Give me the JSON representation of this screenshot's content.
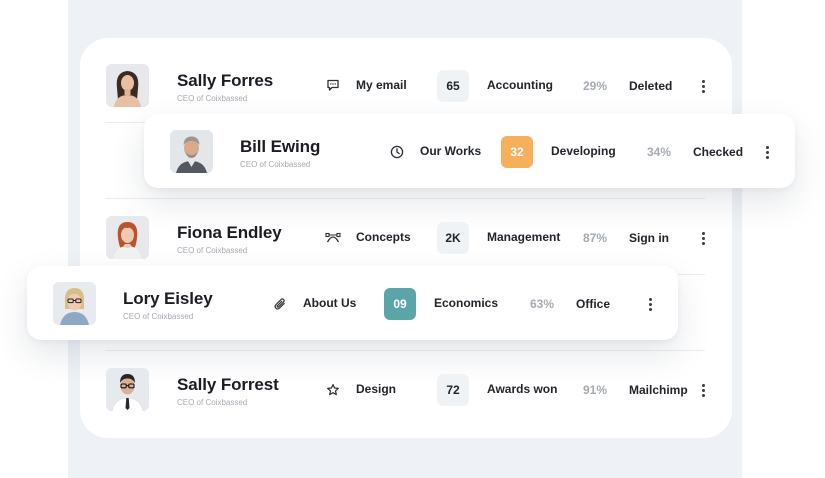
{
  "colors": {
    "background_panel": "#eef2f6",
    "card": "#ffffff",
    "badge_default": "#f0f3f6",
    "badge_orange": "#f6b05c",
    "badge_teal": "#5ba5a9",
    "muted_text": "#a6abb3"
  },
  "rows": [
    {
      "name": "Sally Forres",
      "role": "CEO of Coixbassed",
      "icon": "message-icon",
      "label": "My email",
      "badge": "65",
      "badge_color": "default",
      "category": "Accounting",
      "percent": "29%",
      "status": "Deleted"
    },
    {
      "name": "Bill Ewing",
      "role": "CEO of Coixbassed",
      "icon": "clock-icon",
      "label": "Our Works",
      "badge": "32",
      "badge_color": "orange",
      "category": "Developing",
      "percent": "34%",
      "status": "Checked"
    },
    {
      "name": "Fiona Endley",
      "role": "CEO of Coixbassed",
      "icon": "bezier-curve-icon",
      "label": "Concepts",
      "badge": "2K",
      "badge_color": "default",
      "category": "Management",
      "percent": "87%",
      "status": "Sign in"
    },
    {
      "name": "Lory Eisley",
      "role": "CEO of Coixbassed",
      "icon": "paperclip-icon",
      "label": "About Us",
      "badge": "09",
      "badge_color": "teal",
      "category": "Economics",
      "percent": "63%",
      "status": "Office"
    },
    {
      "name": "Sally Forrest",
      "role": "CEO of Coixbassed",
      "icon": "star-icon",
      "label": "Design",
      "badge": "72",
      "badge_color": "default",
      "category": "Awards won",
      "percent": "91%",
      "status": "Mailchimp"
    }
  ]
}
